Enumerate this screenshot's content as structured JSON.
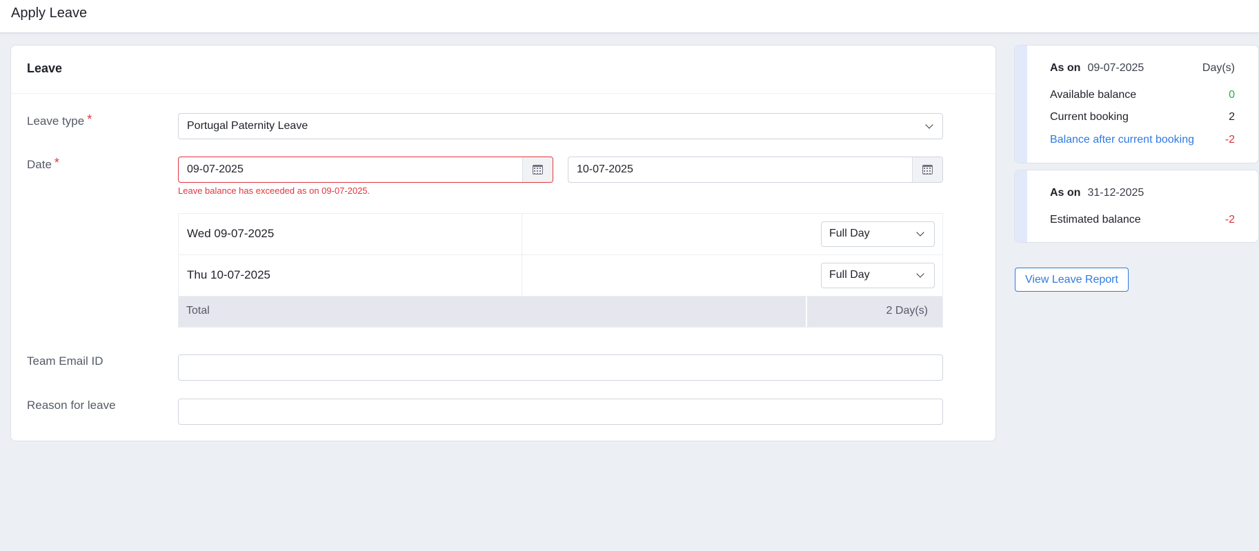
{
  "header": {
    "title": "Apply Leave"
  },
  "form": {
    "card_title": "Leave",
    "leave_type": {
      "label": "Leave type",
      "required_mark": "*",
      "value": "Portugal Paternity Leave"
    },
    "date": {
      "label": "Date",
      "required_mark": "*",
      "from": "09-07-2025",
      "to": "10-07-2025",
      "error": "Leave balance has exceeded as on 09-07-2025."
    },
    "days": [
      {
        "label": "Wed 09-07-2025",
        "session": "Full Day"
      },
      {
        "label": "Thu 10-07-2025",
        "session": "Full Day"
      }
    ],
    "total": {
      "label": "Total",
      "value": "2 Day(s)"
    },
    "team_email": {
      "label": "Team Email ID",
      "value": ""
    },
    "reason": {
      "label": "Reason for leave",
      "value": ""
    }
  },
  "balance_current": {
    "as_on_label": "As on",
    "as_on_date": "09-07-2025",
    "unit": "Day(s)",
    "rows": [
      {
        "label": "Available balance",
        "value": "0"
      },
      {
        "label": "Current booking",
        "value": "2"
      },
      {
        "label": "Balance after current booking",
        "value": "-2"
      }
    ]
  },
  "balance_estimated": {
    "as_on_label": "As on",
    "as_on_date": "31-12-2025",
    "rows": [
      {
        "label": "Estimated balance",
        "value": "-2"
      }
    ]
  },
  "actions": {
    "view_report": "View Leave Report"
  },
  "colors": {
    "accent": "#2f7ae0",
    "error": "#e0353d",
    "positive": "#27ae4a",
    "background": "#eceff4"
  },
  "icons": [
    "calendar-icon",
    "chevron-down-icon"
  ]
}
